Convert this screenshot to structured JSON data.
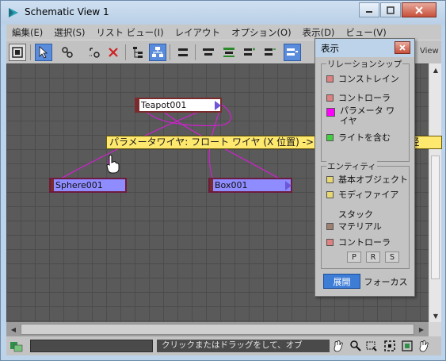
{
  "window": {
    "title": "Schematic View 1"
  },
  "menubar": [
    "編集(E)",
    "選択(S)",
    "リスト ビュー(I)",
    "レイアウト",
    "オプション(O)",
    "表示(D)",
    "ビュー(V)"
  ],
  "toolbar": {
    "view_label": "View"
  },
  "nodes": {
    "teapot": "Teapot001",
    "sphere": "Sphere001",
    "box": "Box001"
  },
  "tooltip": "パラメータワイヤ: フロート ワイヤ (X 位置) -> ベジェ 実数 (半径)(半径",
  "floater": {
    "title": "表示",
    "relationships": {
      "title": "リレーションシップ",
      "items": [
        {
          "label": "コンストレイン",
          "color": "#e08080"
        },
        {
          "label": "コントローラ",
          "color": "#e08080"
        },
        {
          "label": "パラメータ ワイヤ",
          "color": "#ff00ff"
        },
        {
          "label": "ライトを含む",
          "color": "#40d040"
        }
      ]
    },
    "entities": {
      "title": "エンティティ",
      "items": [
        {
          "label": "基本オブジェクト",
          "color": "#e8d870"
        },
        {
          "label": "モディファイア",
          "color": "#e8d870"
        },
        {
          "label": "スタック",
          "color": ""
        },
        {
          "label": "マテリアル",
          "color": "#a08070"
        },
        {
          "label": "コントローラ",
          "color": "#e08080"
        }
      ],
      "prs": [
        "P",
        "R",
        "S"
      ]
    },
    "expand_label": "展開",
    "focus_label": "フォーカス"
  },
  "status": {
    "text": "クリックまたはドラッグをして、オブ"
  }
}
